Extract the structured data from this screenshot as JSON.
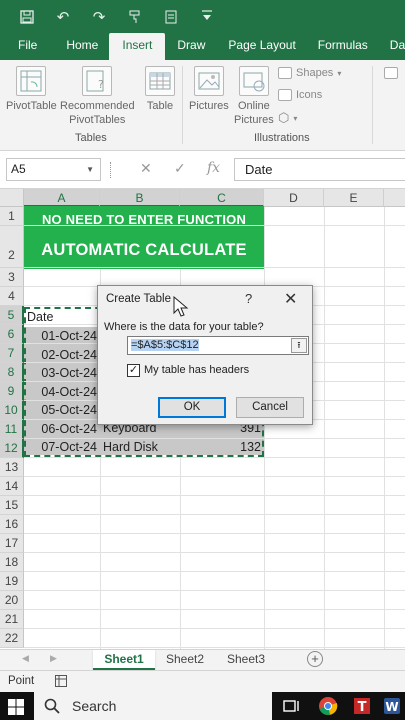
{
  "titlebar": {
    "icons": [
      "save-icon",
      "undo-icon",
      "redo-icon",
      "format-painter-icon",
      "quick-print-icon",
      "customize-icon"
    ]
  },
  "tabs": [
    {
      "label": "File",
      "active": false
    },
    {
      "label": "Home",
      "active": false
    },
    {
      "label": "Insert",
      "active": true
    },
    {
      "label": "Draw",
      "active": false
    },
    {
      "label": "Page Layout",
      "active": false
    },
    {
      "label": "Formulas",
      "active": false
    },
    {
      "label": "Data",
      "active": false
    }
  ],
  "ribbon": {
    "pivottable": "PivotTable",
    "recommended_1": "Recommended",
    "recommended_2": "PivotTables",
    "table": "Table",
    "group_tables": "Tables",
    "pictures": "Pictures",
    "online_1": "Online",
    "online_2": "Pictures",
    "shapes": "Shapes",
    "icons": "Icons",
    "group_illustrations": "Illustrations"
  },
  "formula_bar": {
    "namebox": "A5",
    "fx_symbol": "fx",
    "content": "Date"
  },
  "columns": [
    "A",
    "B",
    "C",
    "D",
    "E"
  ],
  "rows": [
    "1",
    "2",
    "3",
    "4",
    "5",
    "6",
    "7",
    "8",
    "9",
    "10",
    "11",
    "12",
    "13",
    "14",
    "15",
    "16",
    "17",
    "18",
    "19",
    "20",
    "21",
    "22"
  ],
  "banner": {
    "line1": "NO NEED TO ENTER FUNCTION",
    "line2": "AUTOMATIC CALCULATE"
  },
  "cells": {
    "a5": "Date",
    "dates": [
      "01-Oct-24",
      "02-Oct-24",
      "03-Oct-24",
      "04-Oct-24",
      "05-Oct-24",
      "06-Oct-24",
      "07-Oct-24"
    ],
    "b11": "Keyboard",
    "b12": "Hard Disk",
    "c11": "391",
    "c12": "132"
  },
  "dialog": {
    "title": "Create Table",
    "help": "?",
    "close": "✕",
    "prompt": "Where is the data for your table?",
    "range": "=$A$5:$C$12",
    "checkbox_label": "My table has headers",
    "checked": true,
    "ok": "OK",
    "cancel": "Cancel"
  },
  "sheets": [
    {
      "label": "Sheet1",
      "active": true
    },
    {
      "label": "Sheet2",
      "active": false
    },
    {
      "label": "Sheet3",
      "active": false
    }
  ],
  "status": {
    "mode": "Point"
  },
  "taskbar": {
    "search_placeholder": "Search"
  },
  "colors": {
    "excel_green": "#217346",
    "banner_green": "#22b14c",
    "selection_gray": "#c8c8c8"
  }
}
